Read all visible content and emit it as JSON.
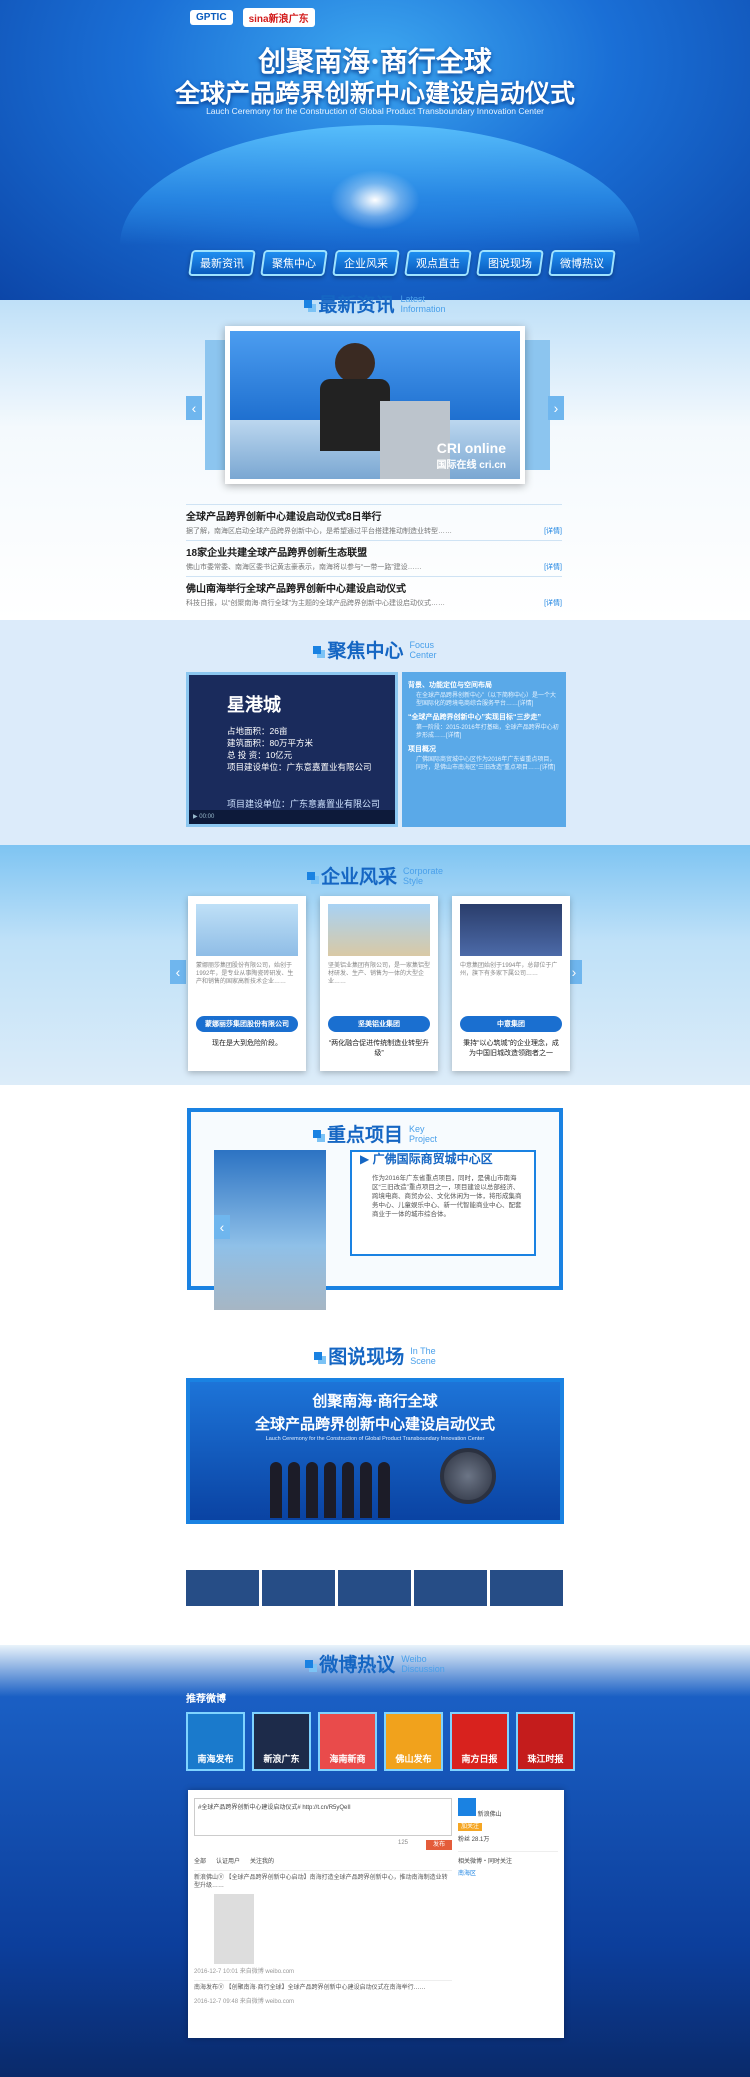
{
  "header": {
    "logo_gptic": "GPTIC",
    "logo_sina": "sina新浪广东",
    "title1": "创聚南海·商行全球",
    "title2": "全球产品跨界创新中心建设启动仪式",
    "subtitle": "Lauch Ceremony for the Construction of Global Product Transboundary Innovation Center"
  },
  "nav": [
    "最新资讯",
    "聚焦中心",
    "企业风采",
    "观点直击",
    "图说现场",
    "微博热议"
  ],
  "news": {
    "cn": "最新资讯",
    "en1": "Latest",
    "en2": "Information",
    "photo_caption": "CRI online",
    "photo_caption2": "国际在线 cri.cn",
    "items": [
      {
        "title": "全球产品跨界创新中心建设启动仪式8日举行",
        "desc": "据了解，南海区启动全球产品跨界创新中心，是希望通过平台搭建推动制造业转型……",
        "more": "[详情]"
      },
      {
        "title": "18家企业共建全球产品跨界创新生态联盟",
        "desc": "佛山市委常委、南海区委书记黄志豪表示，南海将以参与“一带一路”建设……",
        "more": "[详情]"
      },
      {
        "title": "佛山南海举行全球产品跨界创新中心建设启动仪式",
        "desc": "科技日报，以“创聚南海·商行全球”为主题的全球产品跨界创新中心建设启动仪式……",
        "more": "[详情]"
      }
    ]
  },
  "focus": {
    "cn": "聚焦中心",
    "en1": "Focus",
    "en2": "Center",
    "video": {
      "title": "星港城",
      "lines": [
        "占地面积：26亩",
        "建筑面积：80万平方米",
        "总 投 资：10亿元",
        "项目建设单位：广东意嘉置业有限公司"
      ],
      "name": "项目建设单位：广东意嘉置业有限公司",
      "time": "00:00"
    },
    "items": [
      {
        "head": "背景、功能定位与空间布局",
        "desc": "在全球产品跨界创新中心”（以下简称中心）是一个大型国际化的跨境电商综合服务平台……[详情]"
      },
      {
        "head": "“全球产品跨界创新中心”实现目标“三步走”",
        "desc": "第一阶段：2015-2016年打基础，全球产品跨界中心初步形成……[详情]"
      },
      {
        "head": "项目概况",
        "desc": "广佛国际商贸城中心区作为2016年广东省重点项目，同时，是佛山市南海区“三旧改造”重点项目……[详情]"
      }
    ]
  },
  "corporate": {
    "cn": "企业风采",
    "en1": "Corporate",
    "en2": "Style",
    "cards": [
      {
        "text": "蒙娜丽莎集团股份有限公司，始创于1992年，是专业从事陶瓷砖研发、生产和销售的国家高新技术企业……",
        "btn": "蒙娜丽莎集团股份有限公司",
        "cap": "现在是大到危险阶段。"
      },
      {
        "text": "坚美铝业集团有限公司，是一家集铝型材研发、生产、销售为一体的大型企业……",
        "btn": "坚美铝业集团",
        "cap": "“两化融合促进传统制造业转型升级”"
      },
      {
        "text": "中意集团始创于1994年，总部位于广州，旗下有多家下属公司……",
        "btn": "中意集团",
        "cap": "秉持“以心筑城”的企业理念，成为中国旧城改造领跑者之一"
      }
    ]
  },
  "key_project": {
    "cn": "重点项目",
    "en1": "Key",
    "en2": "Project",
    "name": "广佛国际商贸城中心区",
    "text": "作为2016年广东省重点项目，同时，是佛山市南海区“三旧改造”重点项目之一，项目建设以总部经济、跨境电商、商贸办公、文化休闲为一体，将形成集商务中心、儿童娱乐中心、新一代智能商业中心、配套商业于一体的城市综合体。"
  },
  "scene": {
    "cn": "图说现场",
    "en1": "In The",
    "en2": "Scene",
    "t1": "创聚南海·商行全球",
    "t2": "全球产品跨界创新中心建设启动仪式",
    "sub": "Lauch Ceremony for the Construction of Global Product Transboundary Innovation Center",
    "ball": "GPTIC"
  },
  "weibo": {
    "cn": "微博热议",
    "en1": "Weibo",
    "en2": "Discussion",
    "rec_label": "推荐微博",
    "accounts": [
      "南海发布",
      "新浪广东",
      "海南新商",
      "佛山发布",
      "南方日报",
      "珠江时报"
    ],
    "input_text": "#全球产品跨界创新中心建设启动仪式# http://t.cn/R5yQeII",
    "count": "125",
    "send": "发布",
    "tabs": [
      "全部",
      "认证用户",
      "关注我的"
    ],
    "posts": [
      {
        "text": "新浪佛山Ⓥ 【全球产品跨界创新中心启动】南海打造全球产品跨界创新中心，推动南海制造业转型升级……",
        "time": "2016-12-7 10:01 来自微博 weibo.com"
      },
      {
        "text": "南海发布Ⓥ 【创聚南海·商行全球】全球产品跨界创新中心建设启动仪式在南海举行……",
        "time": "2016-12-7 09:48 来自微博 weibo.com"
      }
    ],
    "side": {
      "name": "新浪佛山",
      "follow": "加关注",
      "fans": "粉丝 28.1万",
      "desc": "相关微博・同时关注",
      "note": "南海区"
    }
  }
}
